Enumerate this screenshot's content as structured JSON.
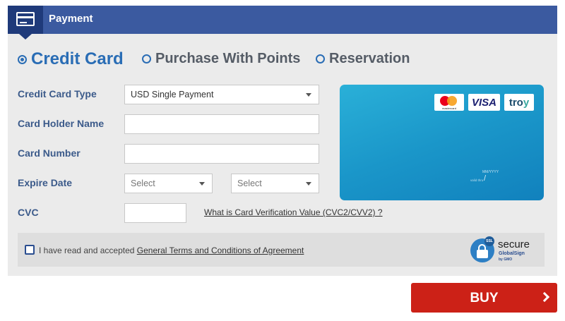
{
  "header": {
    "title": "Payment",
    "icon": "credit-card-icon"
  },
  "tabs": [
    {
      "label": "Credit Card",
      "selected": true
    },
    {
      "label": "Purchase With Points",
      "selected": false
    },
    {
      "label": "Reservation",
      "selected": false
    }
  ],
  "form": {
    "card_type": {
      "label": "Credit Card Type",
      "value": "USD Single Payment"
    },
    "holder_name": {
      "label": "Card Holder Name",
      "value": ""
    },
    "card_number": {
      "label": "Card Number",
      "value": ""
    },
    "expire": {
      "label": "Expire Date",
      "month": "Select",
      "year": "Select"
    },
    "cvc": {
      "label": "CVC",
      "value": "",
      "help_link": "What is Card Verification Value (CVC2/CVV2) ?"
    }
  },
  "card_preview": {
    "brands": [
      "mastercard",
      "VISA",
      "troy"
    ],
    "mastercard_text": "mastercard",
    "visa_text": "VISA",
    "troy_text": "tro",
    "troy_y": "y",
    "valid_text": "valid thru",
    "expiry_placeholder": "MM/YYYY",
    "expiry_slash": "/"
  },
  "agreement": {
    "checked": false,
    "text": "I have read and accepted",
    "link": "General Terms and Conditions of Agreement"
  },
  "ssl_seal": {
    "badge": "SSL",
    "secure": "secure",
    "provider": "GlobalSign",
    "by": "by GMO"
  },
  "buy_button": {
    "label": "BUY"
  },
  "colors": {
    "header": "#3b5aa0",
    "accent": "#2a6db5",
    "buy": "#cc2117",
    "card": "#1a96c9"
  }
}
